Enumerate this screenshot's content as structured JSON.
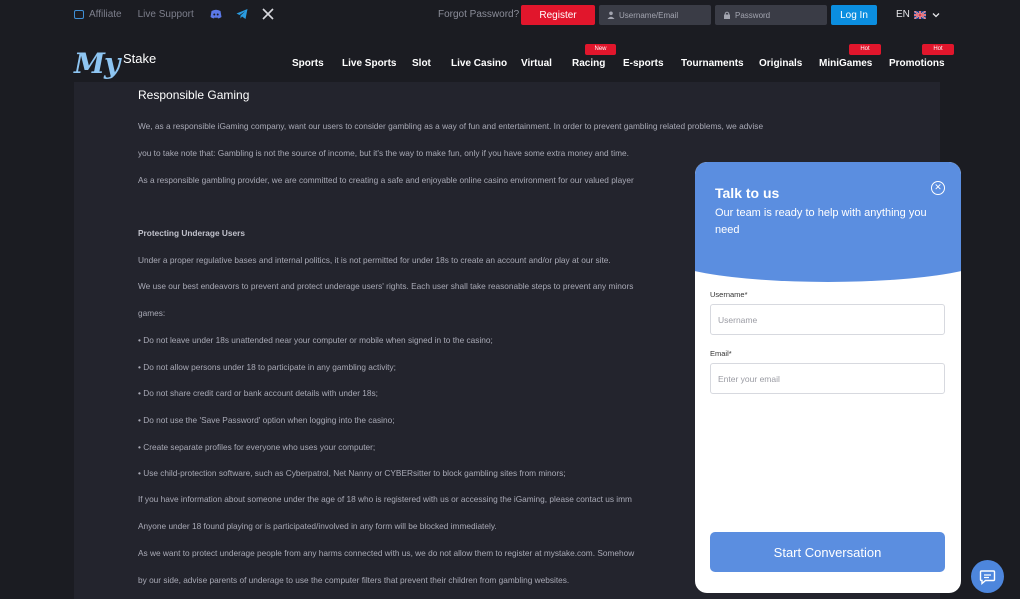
{
  "topbar": {
    "affiliate": "Affiliate",
    "live_support": "Live Support",
    "forgot_password": "Forgot Password?",
    "register": "Register",
    "username_placeholder": "Username/Email",
    "password_placeholder": "Password",
    "login": "Log In",
    "language": "EN"
  },
  "header": {
    "logo_my": "My",
    "logo_stake": "Stake",
    "nav": [
      {
        "label": "Sports",
        "badge": ""
      },
      {
        "label": "Live Sports",
        "badge": ""
      },
      {
        "label": "Slot",
        "badge": ""
      },
      {
        "label": "Live Casino",
        "badge": ""
      },
      {
        "label": "Virtual",
        "badge": ""
      },
      {
        "label": "Racing",
        "badge": "New"
      },
      {
        "label": "E-sports",
        "badge": ""
      },
      {
        "label": "Tournaments",
        "badge": ""
      },
      {
        "label": "Originals",
        "badge": ""
      },
      {
        "label": "MiniGames",
        "badge": "Hot"
      },
      {
        "label": "Promotions",
        "badge": "Hot"
      }
    ]
  },
  "content": {
    "title": "Responsible Gaming",
    "lines": [
      {
        "text": "We, as a responsible iGaming company, want our users to consider gambling as a way of fun and entertainment.  In order to prevent gambling related problems, we advise",
        "bold": false
      },
      {
        "text": "you to take note that: Gambling is not the source of income, but it's the way to make fun, only if you have some extra money and time.",
        "bold": false
      },
      {
        "text": "As a responsible gambling provider, we are committed to creating a safe and enjoyable online casino environment for our valued player",
        "bold": false
      },
      {
        "text": "Protecting Underage Users",
        "bold": true
      },
      {
        "text": "Under a proper regulative bases and internal politics, it is not permitted for under 18s to create an account and/or play at our site.",
        "bold": false
      },
      {
        "text": "We use our best endeavors to prevent and protect underage users' rights. Each user shall take reasonable steps to prevent any minors",
        "bold": false
      },
      {
        "text": "games:",
        "bold": false
      },
      {
        "text": "• Do not leave under 18s unattended near your computer or mobile when signed in to the casino;",
        "bold": false
      },
      {
        "text": "• Do not allow persons under 18 to participate in any gambling activity;",
        "bold": false
      },
      {
        "text": "• Do not share credit card or bank account details with under 18s;",
        "bold": false
      },
      {
        "text": "• Do not use the 'Save Password' option when logging into the casino;",
        "bold": false
      },
      {
        "text": "• Create separate profiles for everyone who uses your computer;",
        "bold": false
      },
      {
        "text": "• Use child-protection software, such as Cyberpatrol, Net Nanny or CYBERsitter to block gambling sites from minors;",
        "bold": false
      },
      {
        "text": "If you have information about someone under the age of 18 who is registered with us or accessing the iGaming, please contact us imm",
        "bold": false
      },
      {
        "text": "Anyone under 18 found playing or is participated/involved in any form will be blocked immediately.",
        "bold": false
      },
      {
        "text": "As we want to protect underage people from any harms connected with us, we do not allow them to register at mystake.com.  Somehow",
        "bold": false
      },
      {
        "text": "by our side, advise parents of underage to use the computer filters that prevent their children from gambling websites.",
        "bold": false
      }
    ]
  },
  "chat": {
    "title": "Talk to us",
    "subtitle": "Our team is ready to help with anything you need",
    "username_label": "Username*",
    "username_placeholder": "Username",
    "email_label": "Email*",
    "email_placeholder": "Enter your email",
    "start_button": "Start Conversation"
  },
  "colors": {
    "accent": "#5b8ee0",
    "register": "#e1162c",
    "login": "#0b8ee0",
    "background": "#1b1c22"
  },
  "icons": [
    "affiliate-icon",
    "discord-icon",
    "telegram-icon",
    "x-icon",
    "user-icon",
    "lock-icon",
    "uk-flag-icon",
    "chevron-down-icon",
    "close-icon",
    "chat-bubble-icon"
  ]
}
